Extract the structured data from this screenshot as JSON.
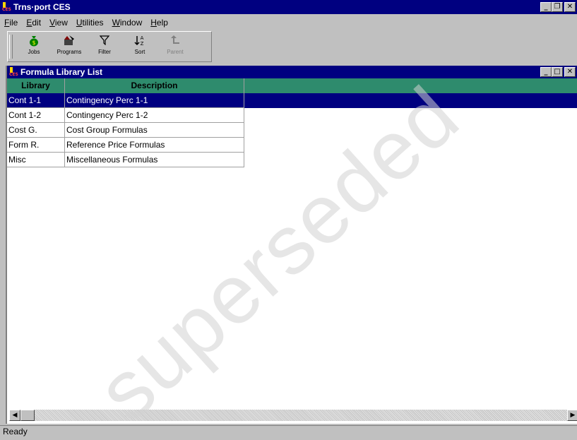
{
  "app": {
    "title": "Trns·port CES",
    "icon_text": "CES"
  },
  "menubar": {
    "items": [
      {
        "label": "File",
        "key": "F",
        "rest": "ile"
      },
      {
        "label": "Edit",
        "key": "E",
        "rest": "dit"
      },
      {
        "label": "View",
        "key": "V",
        "rest": "iew"
      },
      {
        "label": "Utilities",
        "key": "U",
        "rest": "tilities"
      },
      {
        "label": "Window",
        "key": "W",
        "rest": "indow"
      },
      {
        "label": "Help",
        "key": "H",
        "rest": "elp"
      }
    ]
  },
  "toolbar": {
    "jobs": "Jobs",
    "programs": "Programs",
    "filter": "Filter",
    "sort": "Sort",
    "parent": "Parent"
  },
  "child_window": {
    "title": "Formula Library List"
  },
  "grid": {
    "columns": [
      "Library",
      "Description"
    ],
    "rows": [
      {
        "library": "Cont 1-1",
        "description": "Contingency Perc 1-1",
        "selected": true
      },
      {
        "library": "Cont 1-2",
        "description": "Contingency Perc 1-2",
        "selected": false
      },
      {
        "library": "Cost G.",
        "description": "Cost Group Formulas",
        "selected": false
      },
      {
        "library": "Form R.",
        "description": "Reference Price Formulas",
        "selected": false
      },
      {
        "library": "Misc",
        "description": "Miscellaneous Formulas",
        "selected": false
      }
    ]
  },
  "status": {
    "text": "Ready"
  },
  "watermark": "superseded",
  "colors": {
    "titlebar": "#000080",
    "grid_header": "#2e8b6d",
    "selection": "#000080"
  }
}
